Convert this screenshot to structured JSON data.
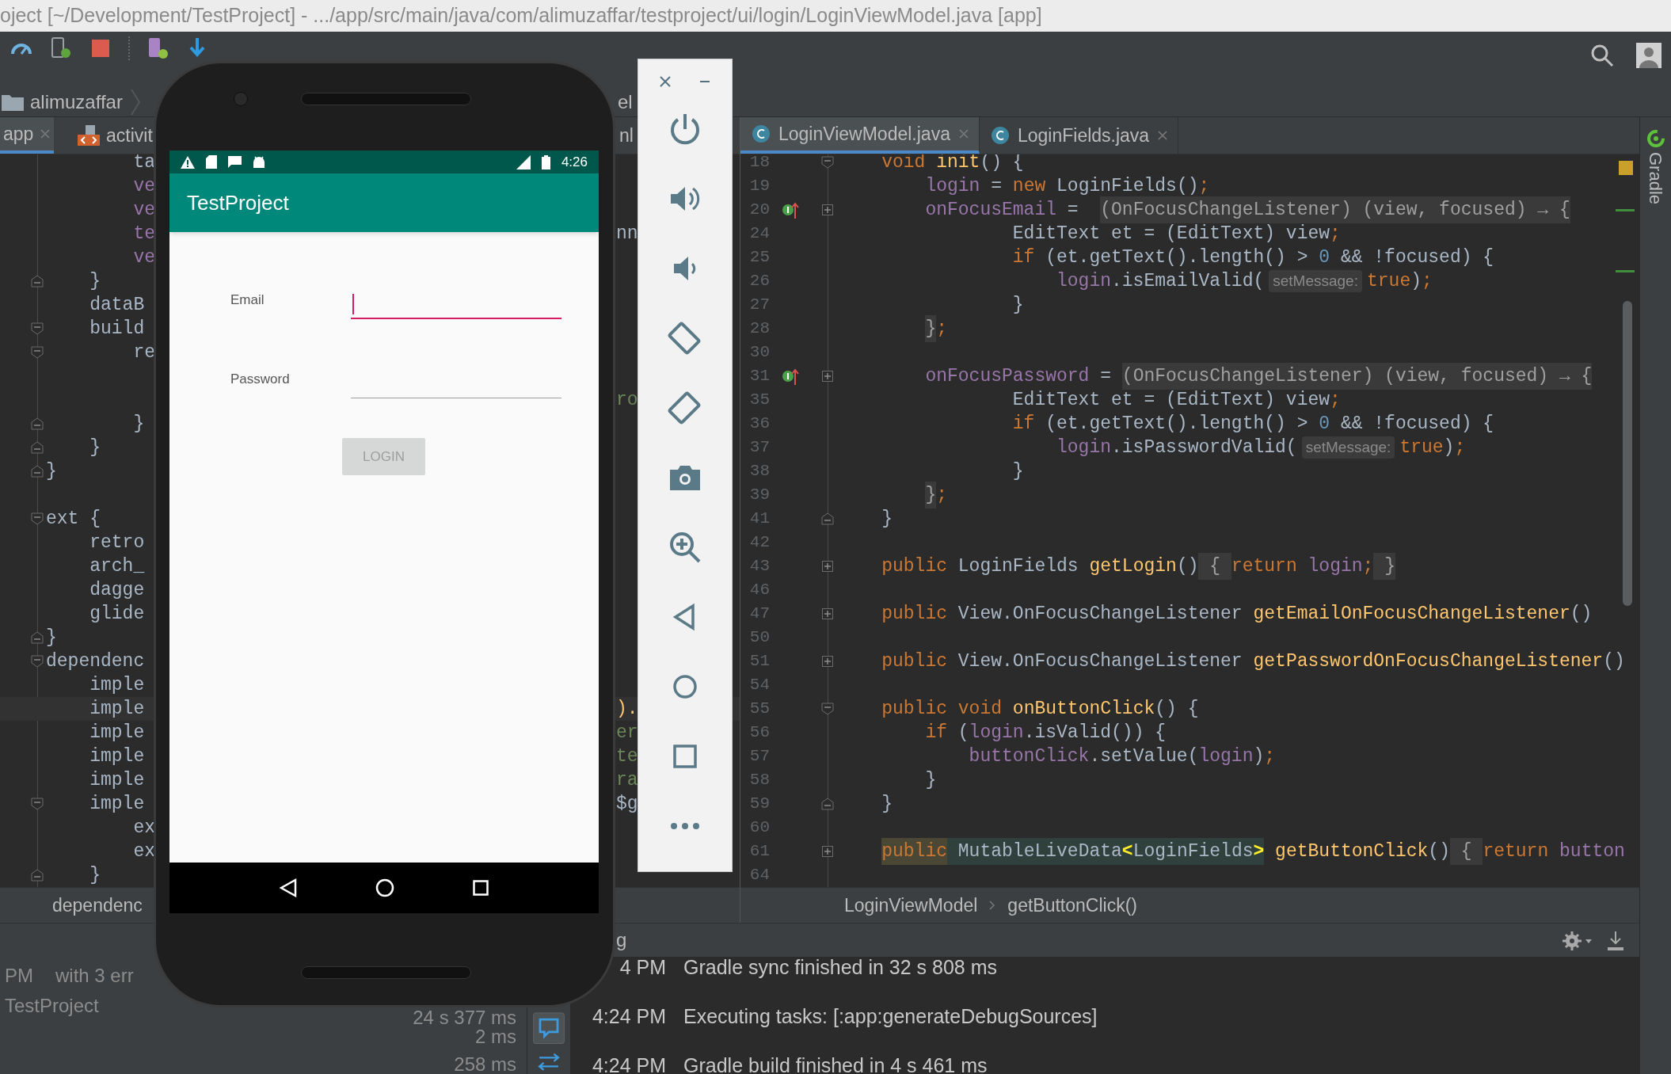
{
  "window": {
    "title": "oject [~/Development/TestProject] - .../app/src/main/java/com/alimuzaffar/testproject/ui/login/LoginViewModel.java [app]"
  },
  "navigation_bar": {
    "breadcrumb": "alimuzaffar",
    "partial_text": "el"
  },
  "left_editor": {
    "tabs": [
      {
        "label": "app",
        "selected": true,
        "kind": "gradle"
      },
      {
        "label": "activit",
        "selected": false,
        "kind": "xml"
      },
      {
        "label": "nl",
        "selected": false,
        "kind": "fragment"
      }
    ],
    "lines": [
      {
        "text": "        ta",
        "kind": "plain",
        "highlighted": false
      },
      {
        "text": "        ve",
        "kind": "field",
        "highlighted": false
      },
      {
        "text": "        ve",
        "kind": "field",
        "highlighted": false
      },
      {
        "text": "        te",
        "kind": "field",
        "highlighted": false,
        "partial_text": {
          "text": "nn",
          "kind": "plain"
        }
      },
      {
        "text": "        ve",
        "kind": "field",
        "highlighted": false
      },
      {
        "text": "    }",
        "kind": "plain",
        "fold": {
          "kind": "close"
        },
        "highlighted": false
      },
      {
        "text": "    dataB",
        "kind": "plain",
        "highlighted": false
      },
      {
        "text": "    build",
        "kind": "plain",
        "fold": {
          "kind": "open"
        },
        "highlighted": false
      },
      {
        "text": "        re",
        "kind": "plain",
        "fold": {
          "kind": "open"
        },
        "highlighted": false
      },
      {
        "highlighted": false
      },
      {
        "highlighted": false,
        "partial_text": {
          "text": "ro",
          "kind": "str"
        }
      },
      {
        "text": "        }",
        "kind": "plain",
        "fold": {
          "kind": "close"
        },
        "highlighted": false
      },
      {
        "text": "    }",
        "kind": "plain",
        "fold": {
          "kind": "close"
        },
        "highlighted": false
      },
      {
        "text": "}",
        "kind": "plain",
        "fold": {
          "kind": "close"
        },
        "highlighted": false
      },
      {
        "highlighted": false
      },
      {
        "text": "ext {",
        "kind": "plain",
        "fold": {
          "kind": "open"
        },
        "highlighted": false
      },
      {
        "text": "    retro",
        "kind": "plain",
        "highlighted": false
      },
      {
        "text": "    arch_",
        "kind": "plain",
        "highlighted": false
      },
      {
        "text": "    dagge",
        "kind": "plain",
        "highlighted": false
      },
      {
        "text": "    glide",
        "kind": "plain",
        "highlighted": false
      },
      {
        "text": "}",
        "kind": "plain",
        "fold": {
          "kind": "close"
        },
        "highlighted": false
      },
      {
        "text": "dependenc",
        "kind": "plain",
        "fold": {
          "kind": "open"
        },
        "highlighted": false
      },
      {
        "text": "    imple",
        "kind": "plain",
        "highlighted": false
      },
      {
        "text": "    imple",
        "kind": "plain",
        "highlighted": true,
        "partial_text": {
          "text": ").",
          "kind": "fn"
        }
      },
      {
        "text": "    imple",
        "kind": "plain",
        "highlighted": false,
        "partial_text": {
          "text": "er",
          "kind": "str"
        }
      },
      {
        "text": "    imple",
        "kind": "plain",
        "highlighted": false,
        "partial_text": {
          "text": "te",
          "kind": "str"
        }
      },
      {
        "text": "    imple",
        "kind": "plain",
        "highlighted": false,
        "partial_text": {
          "text": "ra",
          "kind": "str"
        }
      },
      {
        "text": "    imple",
        "kind": "plain",
        "fold": {
          "kind": "open"
        },
        "highlighted": false,
        "partial_text": {
          "text": "$g",
          "kind": "plain"
        }
      },
      {
        "text": "        ex",
        "kind": "plain",
        "highlighted": false
      },
      {
        "text": "        ex",
        "kind": "plain",
        "highlighted": false
      },
      {
        "text": "    }",
        "kind": "plain",
        "fold": {
          "kind": "close"
        },
        "highlighted": false
      }
    ],
    "breadcrumb": "dependenc"
  },
  "right_editor": {
    "tabs": [
      {
        "label": "LoginViewModel.java",
        "selected": true
      },
      {
        "label": "LoginFields.java",
        "selected": false
      }
    ],
    "lines": [
      {
        "number": "18",
        "fold": {
          "kind": "open"
        },
        "tokens": [
          {
            "text": "    void",
            "kind": "kw"
          },
          {
            "text": " init",
            "kind": "fn"
          },
          {
            "text": "() {",
            "kind": "plain"
          }
        ]
      },
      {
        "number": "19",
        "tokens": [
          {
            "text": "        login",
            "kind": "field"
          },
          {
            "text": " = ",
            "kind": "plain"
          },
          {
            "text": "new",
            "kind": "kw"
          },
          {
            "text": " LoginFields()",
            "kind": "plain"
          },
          {
            "text": ";",
            "kind": "kw"
          }
        ]
      },
      {
        "number": "20",
        "marker": {
          "kind": "implements"
        },
        "fold": {
          "kind": "collapsed"
        },
        "tokens": [
          {
            "text": "        onFocusEmail",
            "kind": "field"
          },
          {
            "text": " =  ",
            "kind": "plain"
          },
          {
            "text": "(OnFocusChangeListener) (view, focused) → {",
            "kind": "folded"
          }
        ]
      },
      {
        "number": "24",
        "tokens": [
          {
            "text": "                EditText et = (EditText) view",
            "kind": "plain"
          },
          {
            "text": ";",
            "kind": "kw"
          }
        ]
      },
      {
        "number": "25",
        "tokens": [
          {
            "text": "                if",
            "kind": "kw"
          },
          {
            "text": " (et.getText().length() > ",
            "kind": "plain"
          },
          {
            "text": "0",
            "kind": "num"
          },
          {
            "text": " && !focused) {",
            "kind": "plain"
          }
        ]
      },
      {
        "number": "26",
        "tokens": [
          {
            "text": "                    login",
            "kind": "field"
          },
          {
            "text": ".isEmailValid(",
            "kind": "plain"
          },
          {
            "text": "setMessage:",
            "kind": "hint"
          },
          {
            "text": "true",
            "kind": "kw"
          },
          {
            "text": ")",
            "kind": "plain"
          },
          {
            "text": ";",
            "kind": "kw"
          }
        ]
      },
      {
        "number": "27",
        "tokens": [
          {
            "text": "                }",
            "kind": "plain"
          }
        ]
      },
      {
        "number": "28",
        "tokens": [
          {
            "text": "        }",
            "kind": "folded"
          },
          {
            "text": ";",
            "kind": "kw"
          }
        ]
      },
      {
        "number": "30"
      },
      {
        "number": "31",
        "marker": {
          "kind": "implements"
        },
        "fold": {
          "kind": "collapsed"
        },
        "tokens": [
          {
            "text": "        onFocusPassword",
            "kind": "field"
          },
          {
            "text": " = ",
            "kind": "plain"
          },
          {
            "text": "(OnFocusChangeListener) (view, focused) → {",
            "kind": "folded"
          }
        ]
      },
      {
        "number": "35",
        "tokens": [
          {
            "text": "                EditText et = (EditText) view",
            "kind": "plain"
          },
          {
            "text": ";",
            "kind": "kw"
          }
        ]
      },
      {
        "number": "36",
        "tokens": [
          {
            "text": "                if",
            "kind": "kw"
          },
          {
            "text": " (et.getText().length() > ",
            "kind": "plain"
          },
          {
            "text": "0",
            "kind": "num"
          },
          {
            "text": " && !focused) {",
            "kind": "plain"
          }
        ]
      },
      {
        "number": "37",
        "tokens": [
          {
            "text": "                    login",
            "kind": "field"
          },
          {
            "text": ".isPasswordValid(",
            "kind": "plain"
          },
          {
            "text": "setMessage:",
            "kind": "hint"
          },
          {
            "text": "true",
            "kind": "kw"
          },
          {
            "text": ")",
            "kind": "plain"
          },
          {
            "text": ";",
            "kind": "kw"
          }
        ]
      },
      {
        "number": "38",
        "tokens": [
          {
            "text": "                }",
            "kind": "plain"
          }
        ]
      },
      {
        "number": "39",
        "tokens": [
          {
            "text": "        }",
            "kind": "folded"
          },
          {
            "text": ";",
            "kind": "kw"
          }
        ]
      },
      {
        "number": "41",
        "fold": {
          "kind": "close"
        },
        "tokens": [
          {
            "text": "    }",
            "kind": "plain"
          }
        ]
      },
      {
        "number": "42"
      },
      {
        "number": "43",
        "fold": {
          "kind": "collapsed"
        },
        "tokens": [
          {
            "text": "    public",
            "kind": "kw"
          },
          {
            "text": " LoginFields ",
            "kind": "plain"
          },
          {
            "text": "getLogin",
            "kind": "fn"
          },
          {
            "text": "()",
            "kind": "plain"
          },
          {
            "text": " { ",
            "kind": "folded"
          },
          {
            "text": "return",
            "kind": "kw"
          },
          {
            "text": " login",
            "kind": "field"
          },
          {
            "text": ";",
            "kind": "kw"
          },
          {
            "text": " }",
            "kind": "folded"
          }
        ]
      },
      {
        "number": "46"
      },
      {
        "number": "47",
        "fold": {
          "kind": "collapsed"
        },
        "tokens": [
          {
            "text": "    public",
            "kind": "kw"
          },
          {
            "text": " View.OnFocusChangeListener ",
            "kind": "plain"
          },
          {
            "text": "getEmailOnFocusChangeListener",
            "kind": "fn"
          },
          {
            "text": "()",
            "kind": "plain"
          }
        ]
      },
      {
        "number": "50"
      },
      {
        "number": "51",
        "fold": {
          "kind": "collapsed"
        },
        "tokens": [
          {
            "text": "    public",
            "kind": "kw"
          },
          {
            "text": " View.OnFocusChangeListener ",
            "kind": "plain"
          },
          {
            "text": "getPasswordOnFocusChangeListener",
            "kind": "fn"
          },
          {
            "text": "()",
            "kind": "plain"
          }
        ]
      },
      {
        "number": "54"
      },
      {
        "number": "55",
        "fold": {
          "kind": "open"
        },
        "tokens": [
          {
            "text": "    public",
            "kind": "kw"
          },
          {
            "text": " void",
            "kind": "kw"
          },
          {
            "text": " onButtonClick",
            "kind": "fn"
          },
          {
            "text": "() {",
            "kind": "plain"
          }
        ]
      },
      {
        "number": "56",
        "tokens": [
          {
            "text": "        if",
            "kind": "kw"
          },
          {
            "text": " (",
            "kind": "plain"
          },
          {
            "text": "login",
            "kind": "field"
          },
          {
            "text": ".isValid()) {",
            "kind": "plain"
          }
        ]
      },
      {
        "number": "57",
        "tokens": [
          {
            "text": "            buttonClick",
            "kind": "field"
          },
          {
            "text": ".setValue(",
            "kind": "plain"
          },
          {
            "text": "login",
            "kind": "field"
          },
          {
            "text": ")",
            "kind": "plain"
          },
          {
            "text": ";",
            "kind": "kw"
          }
        ]
      },
      {
        "number": "58",
        "tokens": [
          {
            "text": "        }",
            "kind": "plain"
          }
        ]
      },
      {
        "number": "59",
        "fold": {
          "kind": "close"
        },
        "tokens": [
          {
            "text": "    }",
            "kind": "plain"
          }
        ]
      },
      {
        "number": "60"
      },
      {
        "number": "61",
        "fold": {
          "kind": "collapsed"
        },
        "tokens": [
          {
            "text": "    public",
            "kind": "kw_mark"
          },
          {
            "text": " MutableLiveData",
            "kind": "type_mark"
          },
          {
            "text": "<",
            "kind": "brace_match"
          },
          {
            "text": "LoginFields",
            "kind": "type_mark"
          },
          {
            "text": ">",
            "kind": "brace_match"
          },
          {
            "text": " getButtonClick",
            "kind": "fn"
          },
          {
            "text": "()",
            "kind": "plain"
          },
          {
            "text": " { ",
            "kind": "folded"
          },
          {
            "text": "return",
            "kind": "kw"
          },
          {
            "text": " button",
            "kind": "field"
          }
        ]
      },
      {
        "number": "64"
      }
    ],
    "breadcrumb": [
      "LoginViewModel",
      "getButtonClick()"
    ]
  },
  "build_panel": {
    "header_partial": "g",
    "tree_rows": [
      {
        "column_1": "PM",
        "column_2": "with 3 err"
      },
      {
        "column_1": "TestProject",
        "time": "24 s 377 ms"
      },
      {
        "time": "2 ms"
      },
      {
        "time": "258 ms"
      }
    ],
    "log": [
      {
        "time": "4 PM",
        "message": "Gradle sync finished in 32 s 808 ms"
      },
      {
        "time": "4:24 PM",
        "message": "Executing tasks: [:app:generateDebugSources]"
      },
      {
        "time": "4:24 PM",
        "message": "Gradle build finished in 4 s 461 ms"
      }
    ]
  },
  "side_tool_window": {
    "label": "Gradle"
  },
  "emulator": {
    "status_time": "4:26",
    "app_title": "TestProject",
    "fields": [
      {
        "label": "Email",
        "focused": true
      },
      {
        "label": "Password",
        "focused": false
      }
    ],
    "button": {
      "label": "LOGIN",
      "disabled": true
    }
  }
}
